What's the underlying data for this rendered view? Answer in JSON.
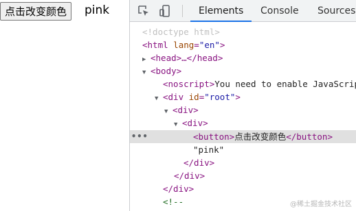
{
  "app": {
    "button_label": "点击改变颜色",
    "text": "pink"
  },
  "devtools": {
    "tabs": [
      {
        "label": "Elements",
        "active": true
      },
      {
        "label": "Console",
        "active": false
      },
      {
        "label": "Sources",
        "active": false
      }
    ],
    "icons": [
      "inspect-element-icon",
      "device-toolbar-icon"
    ],
    "accent_color": "#1a73e8",
    "dom_tree": {
      "doctype": "<!doctype html>",
      "html_open": "<html",
      "html_attr": "lang",
      "html_attr_value": "\"en\"",
      "head": "<head>…</head>",
      "body_open": "<body>",
      "noscript_open": "<noscript>",
      "noscript_text": "You need to enable JavaScript",
      "div_root_open": "<div",
      "div_root_attr": "id",
      "div_root_value": "\"root\"",
      "div_open": "<div>",
      "button_open": "<button>",
      "button_text": "点击改变颜色",
      "button_close": "</button>",
      "text_node": "\"pink\"",
      "div_close": "</div>",
      "comment": "<!--",
      "dots": "•••"
    }
  },
  "watermark": "@稀土掘金技术社区"
}
